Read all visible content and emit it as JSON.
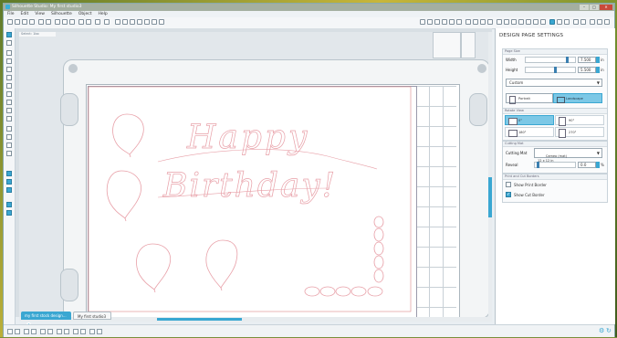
{
  "app": {
    "title": "Silhouette Studio: My first studio3"
  },
  "window": {
    "minimize": "–",
    "maximize": "□",
    "close": "✕"
  },
  "menu": [
    "File",
    "Edit",
    "View",
    "Silhouette",
    "Object",
    "Help"
  ],
  "canvas": {
    "ruler_tab": "Select: 1bo",
    "artwork": {
      "line1": "Happy",
      "line2": "Birthday!",
      "stroke_color": "#e8a0a8"
    }
  },
  "document_tabs": [
    {
      "label": "my first stock design...",
      "active": true
    },
    {
      "label": "My first studio3",
      "active": false
    }
  ],
  "panel": {
    "title": "DESIGN PAGE SETTINGS",
    "page_size": {
      "header": "Page Size",
      "width_label": "Width",
      "width_value": "7.500",
      "width_unit": "in",
      "height_label": "Height",
      "height_value": "5.500",
      "height_unit": "in",
      "preset": "Custom",
      "portrait": "Portrait",
      "landscape": "Landscape",
      "width_level": 0.85,
      "height_level": 0.6
    },
    "rotate_view": {
      "header": "Rotate View",
      "options": [
        "0°",
        "90°",
        "180°",
        "270°"
      ],
      "selected": "0°"
    },
    "cutting_mat": {
      "header": "Cutting Mat",
      "label": "Cutting Mat",
      "value": "Cameo (mat)\n12 x 12 in",
      "reveal_label": "Reveal",
      "reveal_value": "0.0",
      "reveal_unit": "%",
      "reveal_level": 0.05
    },
    "print_cut": {
      "header": "Print and Cut Borders",
      "show_print_border": "Show Print Border",
      "show_print_checked": false,
      "show_cut_border": "Show Cut Border",
      "show_cut_checked": true
    }
  },
  "colors": {
    "accent": "#3aa7d2",
    "artwork": "#e8a0a8"
  }
}
